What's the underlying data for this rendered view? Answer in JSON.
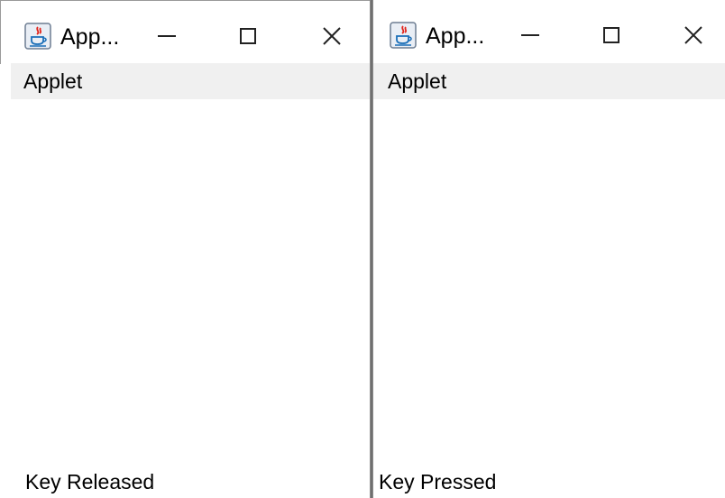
{
  "windows": [
    {
      "title": "App...",
      "menu": [
        "Applet"
      ],
      "status_text": "Key Released"
    },
    {
      "title": "App...",
      "menu": [
        "Applet"
      ],
      "status_text": "Key Pressed"
    }
  ],
  "icons": {
    "app": "java-coffee-icon",
    "minimize": "minimize-icon",
    "maximize": "maximize-icon",
    "close": "close-icon"
  },
  "colors": {
    "menubar_bg": "#f0f0f0",
    "window_bg": "#ffffff",
    "divider": "#7a7a7a"
  }
}
